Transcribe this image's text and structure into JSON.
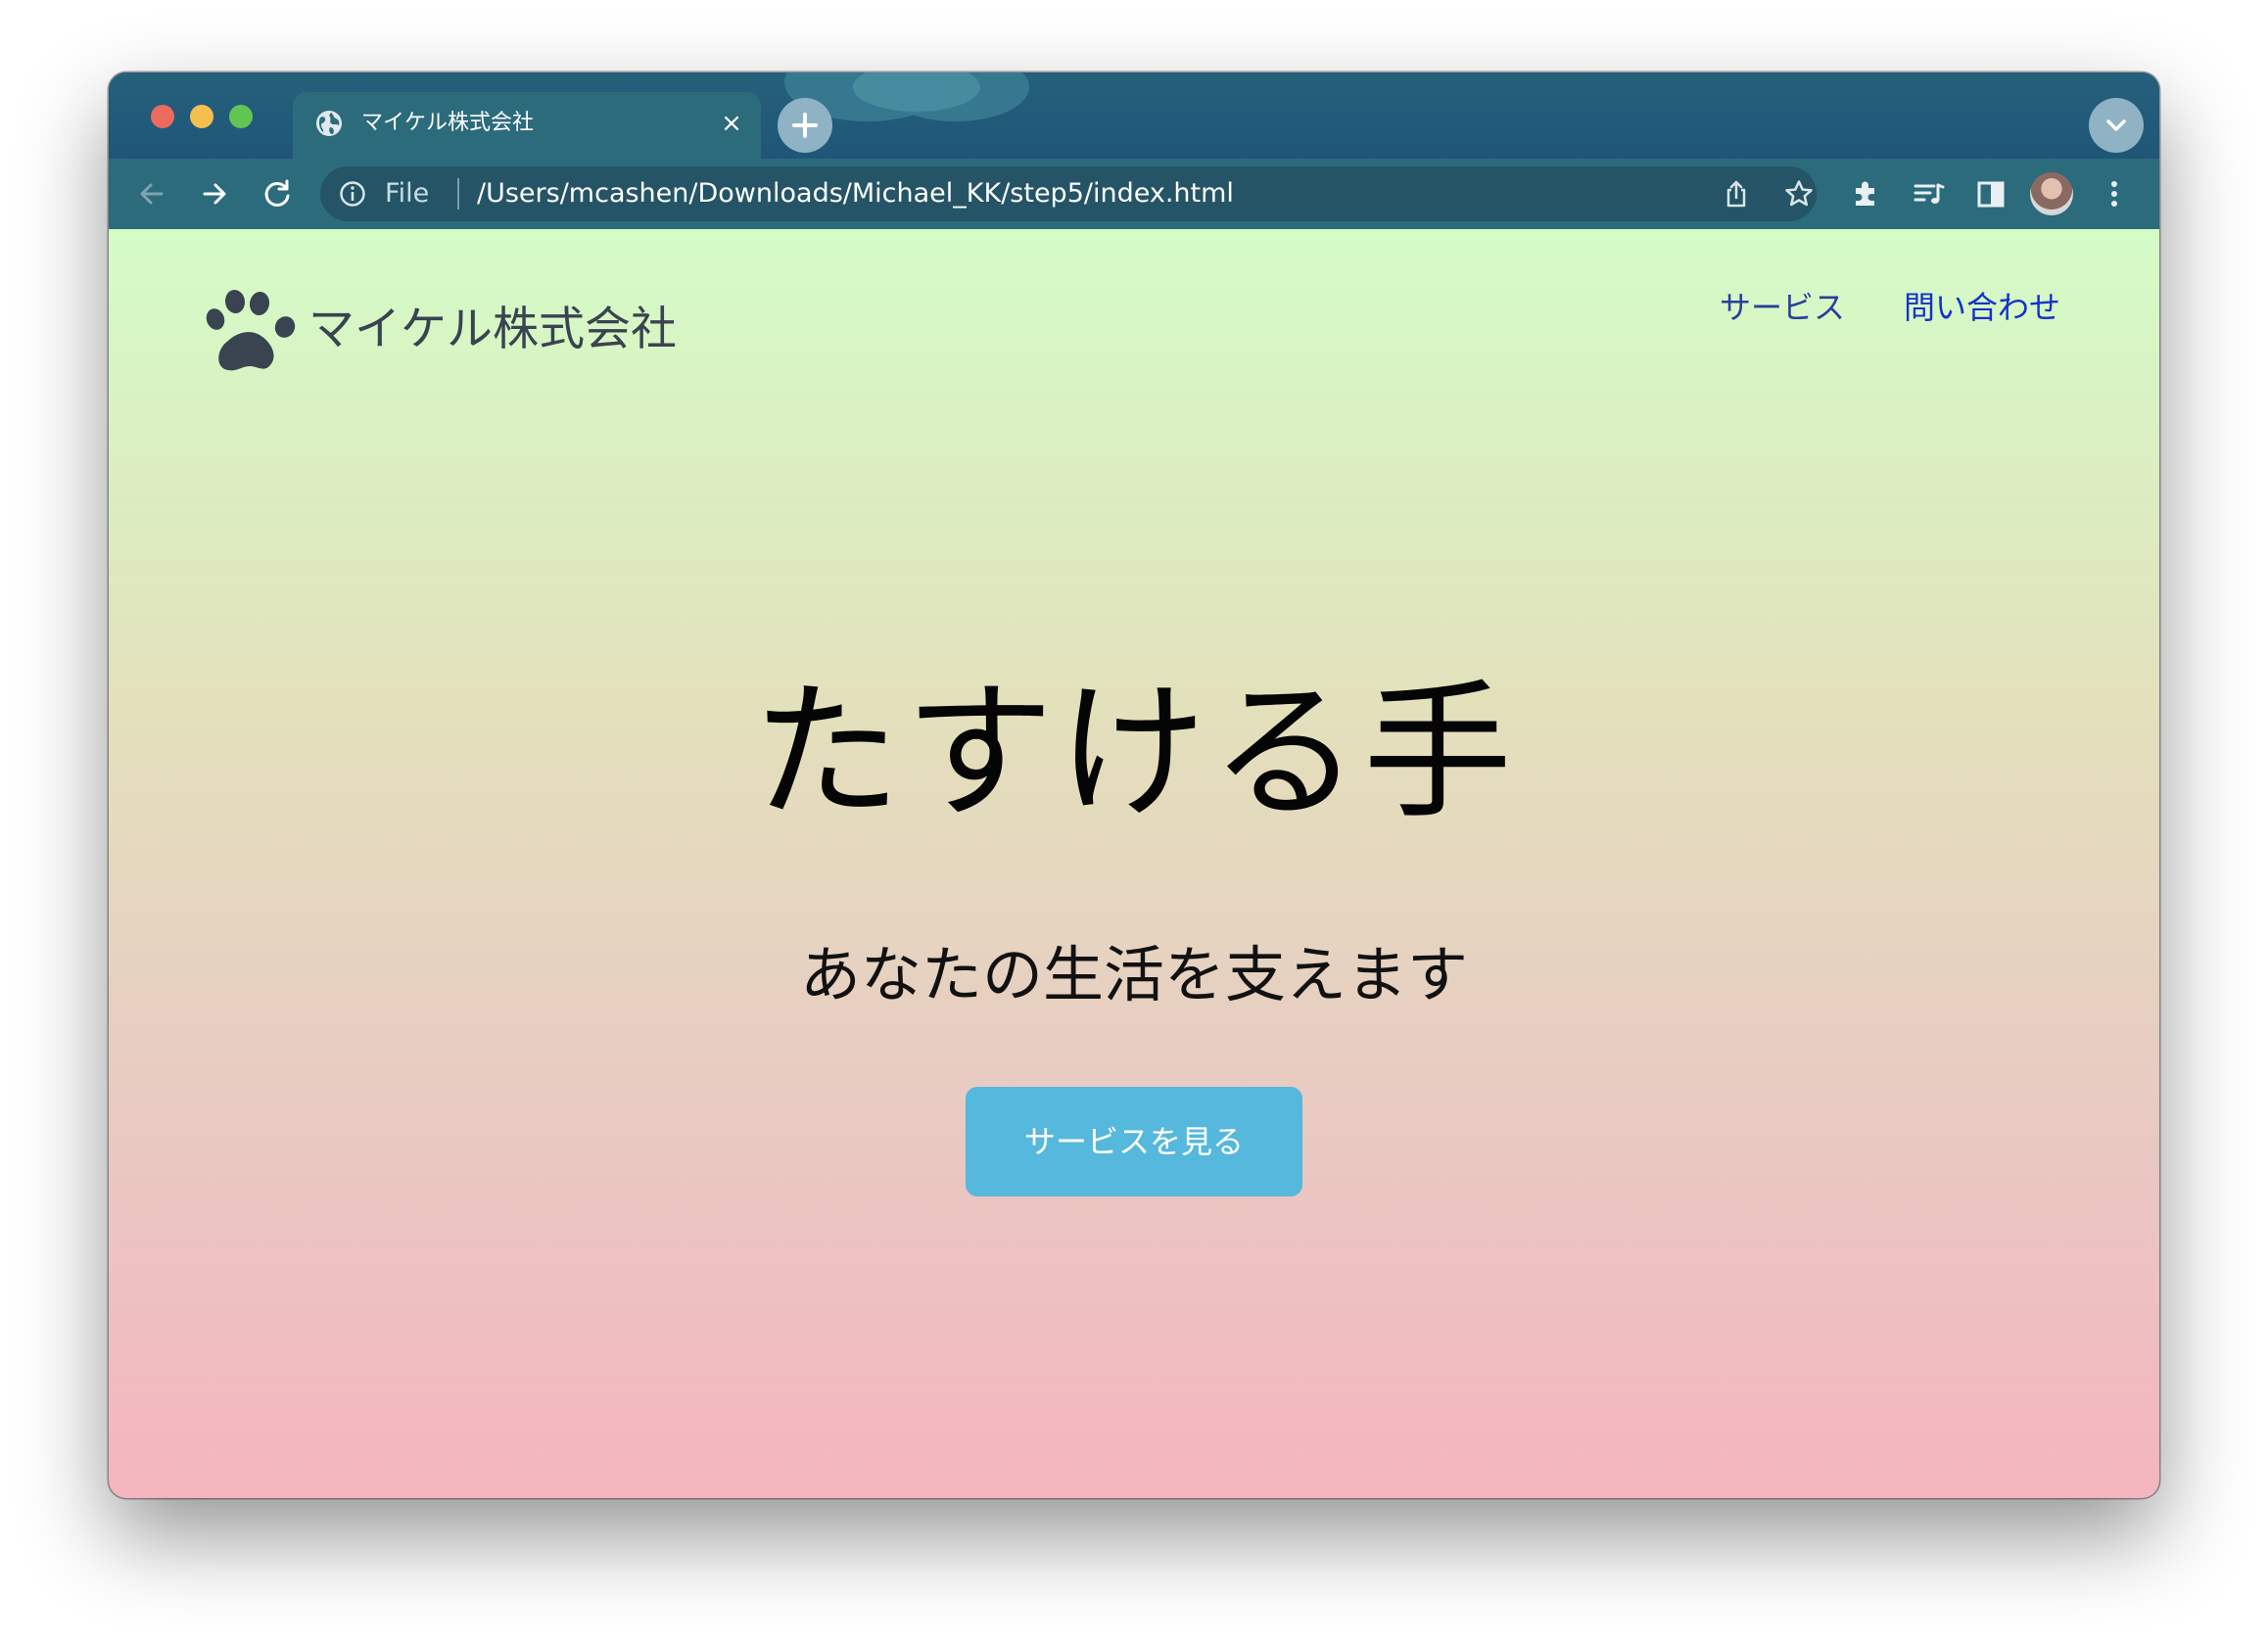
{
  "browser": {
    "tab": {
      "title": "マイケル株式会社",
      "close_glyph": "×",
      "icon": "globe-icon"
    },
    "toolbar": {
      "scheme_label": "File",
      "url": "/Users/mcashen/Downloads/Michael_KK/step5/index.html"
    },
    "colors": {
      "frame": "#1f5677",
      "toolbar": "#2b6b7c",
      "omnibox": "#245465"
    }
  },
  "page": {
    "logo": {
      "icon": "paw-icon",
      "text": "マイケル株式会社"
    },
    "nav": {
      "services": "サービス",
      "contact": "問い合わせ"
    },
    "hero": {
      "title": "たすける手",
      "subtitle": "あなたの生活を支えます",
      "cta_label": "サービスを見る"
    },
    "colors": {
      "gradient_top": "#d4fcc7",
      "gradient_bottom": "#f4b5bf",
      "cta": "#55b8dc",
      "nav_link": "#1432c8"
    }
  }
}
